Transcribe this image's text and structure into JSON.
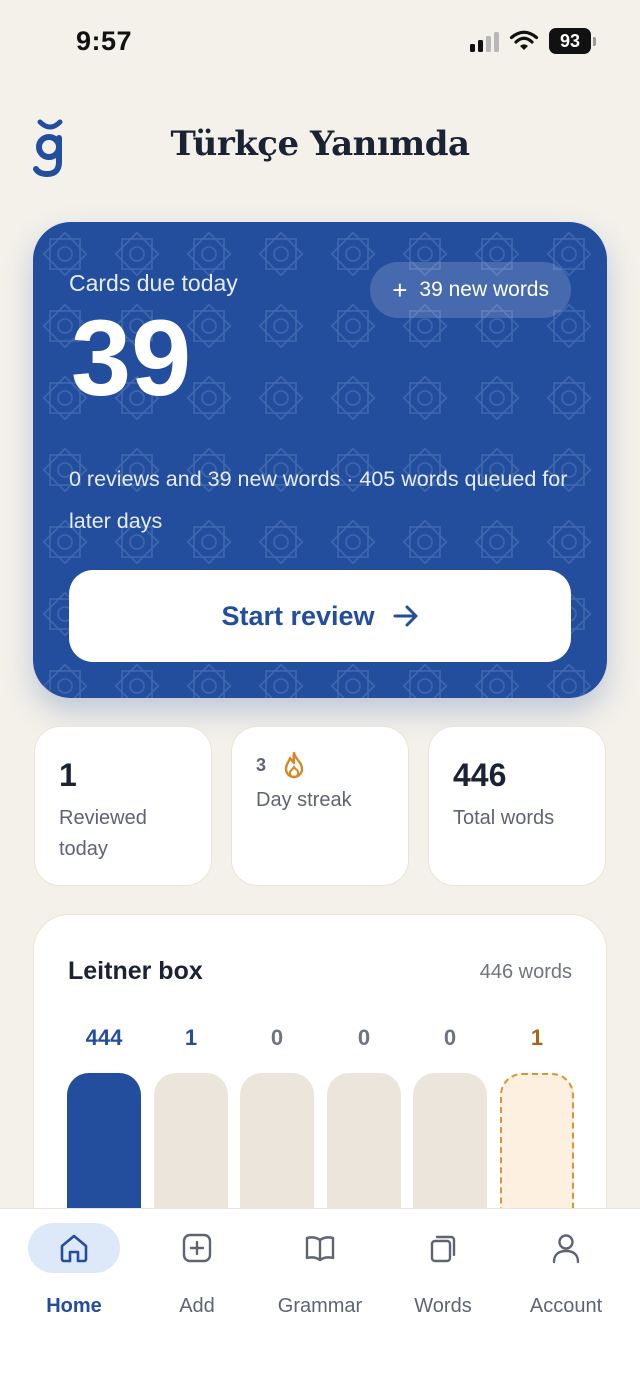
{
  "status_bar": {
    "time": "9:57",
    "battery": "93"
  },
  "header": {
    "title": "Türkçe Yanımda",
    "logo_icon": "g-breve-logo"
  },
  "hero": {
    "label": "Cards due today",
    "count": "39",
    "new_words_pill": "39 new words",
    "description": "0 reviews and 39 new words · 405 words queued for later days",
    "start_button": "Start review",
    "colors": {
      "background": "#234e9e",
      "text": "#ffffff"
    }
  },
  "stats": {
    "reviewed": {
      "value": "1",
      "label": "Reviewed today"
    },
    "streak": {
      "value": "3",
      "label": "Day streak",
      "icon": "flame-icon"
    },
    "total": {
      "value": "446",
      "label": "Total words"
    }
  },
  "leitner": {
    "title": "Leitner box",
    "count_label": "446 words",
    "boxes": [
      {
        "value": "444"
      },
      {
        "value": "1"
      },
      {
        "value": "0"
      },
      {
        "value": "0"
      },
      {
        "value": "0"
      },
      {
        "value": "1"
      }
    ]
  },
  "nav": {
    "items": [
      {
        "label": "Home",
        "icon": "home-icon",
        "active": true
      },
      {
        "label": "Add",
        "icon": "add-square-icon"
      },
      {
        "label": "Grammar",
        "icon": "book-icon"
      },
      {
        "label": "Words",
        "icon": "cards-icon"
      },
      {
        "label": "Account",
        "icon": "user-icon"
      }
    ]
  }
}
